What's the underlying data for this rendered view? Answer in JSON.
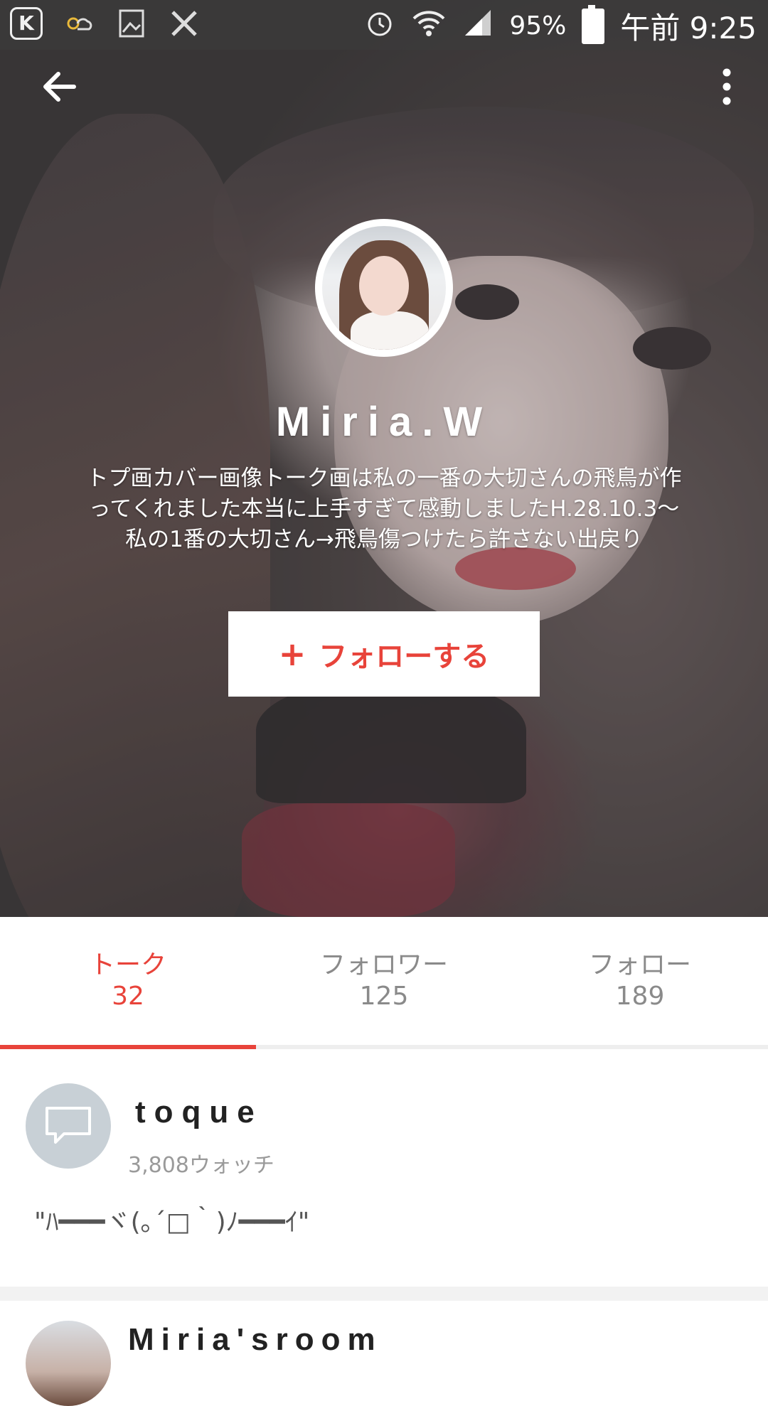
{
  "status_bar": {
    "battery": "95%",
    "time": "午前 9:25",
    "icons": [
      "k-app-icon",
      "weather-sun-cloud-icon",
      "photo-icon",
      "tools-icon",
      "alarm-icon",
      "wifi-icon",
      "signal-icon",
      "battery-charging-icon"
    ]
  },
  "header": {
    "back_icon": "arrow-back-icon",
    "more_icon": "more-vertical-icon"
  },
  "profile": {
    "name": "Miria.W",
    "bio": "トプ画カバー画像トーク画は私の一番の大切さんの飛鳥が作ってくれました本当に上手すぎて感動しましたH.28.10.3〜私の1番の大切さん→飛鳥傷つけたら許さない出戻り",
    "follow_label": "フォローする",
    "follow_icon": "+"
  },
  "tabs": [
    {
      "label": "トーク",
      "count": "32",
      "active": true
    },
    {
      "label": "フォロワー",
      "count": "125",
      "active": false
    },
    {
      "label": "フォロー",
      "count": "189",
      "active": false
    }
  ],
  "talks": [
    {
      "title": "toque",
      "watch": "3,808ウォッチ",
      "body": "\"ﾊ━━━ヾ(｡´□｀)ﾉ━━━ｲ\"",
      "icon": "chat-bubble-icon"
    },
    {
      "title": "Miria'sroom"
    }
  ],
  "colors": {
    "accent": "#e8433a",
    "tab_inactive": "#8a8a8a",
    "icon_bg": "#c8d0d6"
  }
}
